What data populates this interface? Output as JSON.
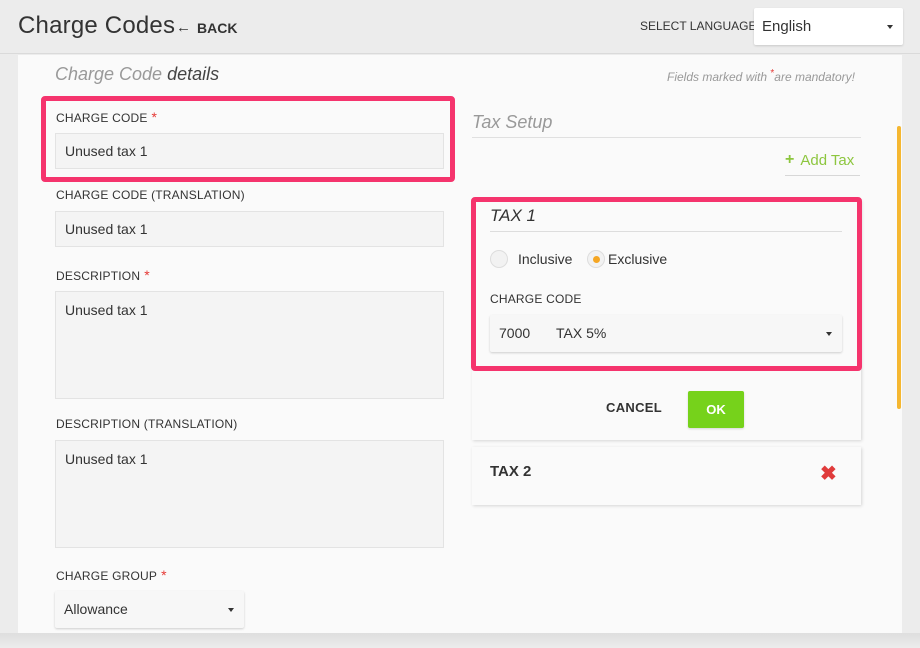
{
  "header": {
    "title": "Charge Codes",
    "back_label": "BACK",
    "language_label": "SELECT LANGUAGE",
    "language_value": "English"
  },
  "details": {
    "title_light": "Charge Code",
    "title_strong": "details",
    "mandatory_prefix": "Fields marked with",
    "mandatory_star": "*",
    "mandatory_suffix": "are mandatory!"
  },
  "form": {
    "charge_code_label": "CHARGE CODE",
    "charge_code_value": "Unused tax 1",
    "charge_code_translation_label": "CHARGE CODE (TRANSLATION)",
    "charge_code_translation_value": "Unused tax 1",
    "description_label": "DESCRIPTION",
    "description_value": "Unused tax 1",
    "description_translation_label": "DESCRIPTION (TRANSLATION)",
    "description_translation_value": "Unused tax 1",
    "charge_group_label": "CHARGE GROUP",
    "charge_group_value": "Allowance",
    "required_marker": "*"
  },
  "tax_setup": {
    "title": "Tax Setup",
    "add_tax_label": "Add Tax",
    "tax1": {
      "title": "TAX 1",
      "inclusive_label": "Inclusive",
      "exclusive_label": "Exclusive",
      "selected": "Exclusive",
      "charge_code_label": "CHARGE CODE",
      "charge_code_number": "7000",
      "charge_code_name": "TAX 5%"
    },
    "cancel_label": "CANCEL",
    "ok_label": "OK",
    "tax2": {
      "title": "TAX 2"
    }
  },
  "colors": {
    "highlight": "#f5346d",
    "ok_button": "#76d21b",
    "add_tax": "#8dc63f",
    "required": "#e53935",
    "radio_selected": "#f5a623",
    "delete": "#e03b3b",
    "scroll_indicator": "#f5b731"
  },
  "icons": {
    "back": "arrow-left-icon",
    "add": "plus-icon",
    "delete": "close-x-icon",
    "dropdown": "caret-down-icon"
  }
}
